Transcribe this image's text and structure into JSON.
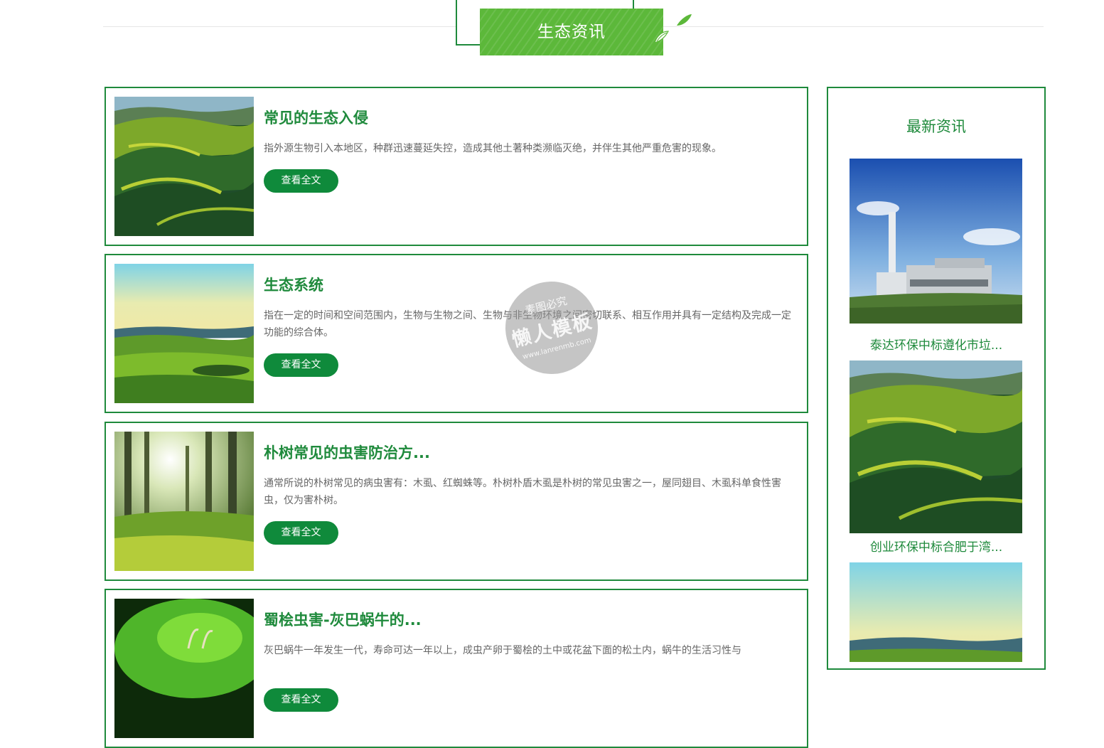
{
  "section": {
    "title": "生态资讯"
  },
  "articles": [
    {
      "title": "常见的生态入侵",
      "desc": "指外源生物引入本地区，种群迅速蔓延失控，造成其他土著种类濒临灭绝，并伴生其他严重危害的现象。",
      "button": "查看全文",
      "image": "rolling-green-hills"
    },
    {
      "title": "生态系统",
      "desc": "指在一定的时间和空间范围内，生物与生物之间、生物与非生物环境之间密切联系、相互作用并具有一定结构及完成一定功能的综合体。",
      "button": "查看全文",
      "image": "grassland-horizon"
    },
    {
      "title": "朴树常见的虫害防治方...",
      "desc": "通常所说的朴树常见的病虫害有：木虱、红蜘蛛等。朴树朴盾木虱是朴树的常见虫害之一，屋同翅目、木虱科单食性害虫，仅为害朴树。",
      "button": "查看全文",
      "image": "sunlit-forest"
    },
    {
      "title": "蜀桧虫害-灰巴蜗牛的...",
      "desc": "灰巴蜗牛一年发生一代，寿命可达一年以上，成虫产卵于蜀桧的土中或花盆下面的松土内，蜗牛的生活习性与",
      "button": "查看全文",
      "image": "snail-on-leaf"
    }
  ],
  "sidebar": {
    "title": "最新资讯",
    "items": [
      {
        "caption": "泰达环保中标遵化市垃...",
        "image": "incineration-plant"
      },
      {
        "caption": "创业环保中标合肥于湾...",
        "image": "rolling-green-hills"
      },
      {
        "caption": "",
        "image": "grassland-horizon"
      }
    ]
  },
  "watermark": {
    "line1": "素图必究",
    "line2": "懒人模板",
    "line3": "www.lanrenmb.com"
  },
  "colors": {
    "brand_green": "#1f8a3c",
    "button_green": "#0f8a3b",
    "header_green": "#5cb83a"
  }
}
